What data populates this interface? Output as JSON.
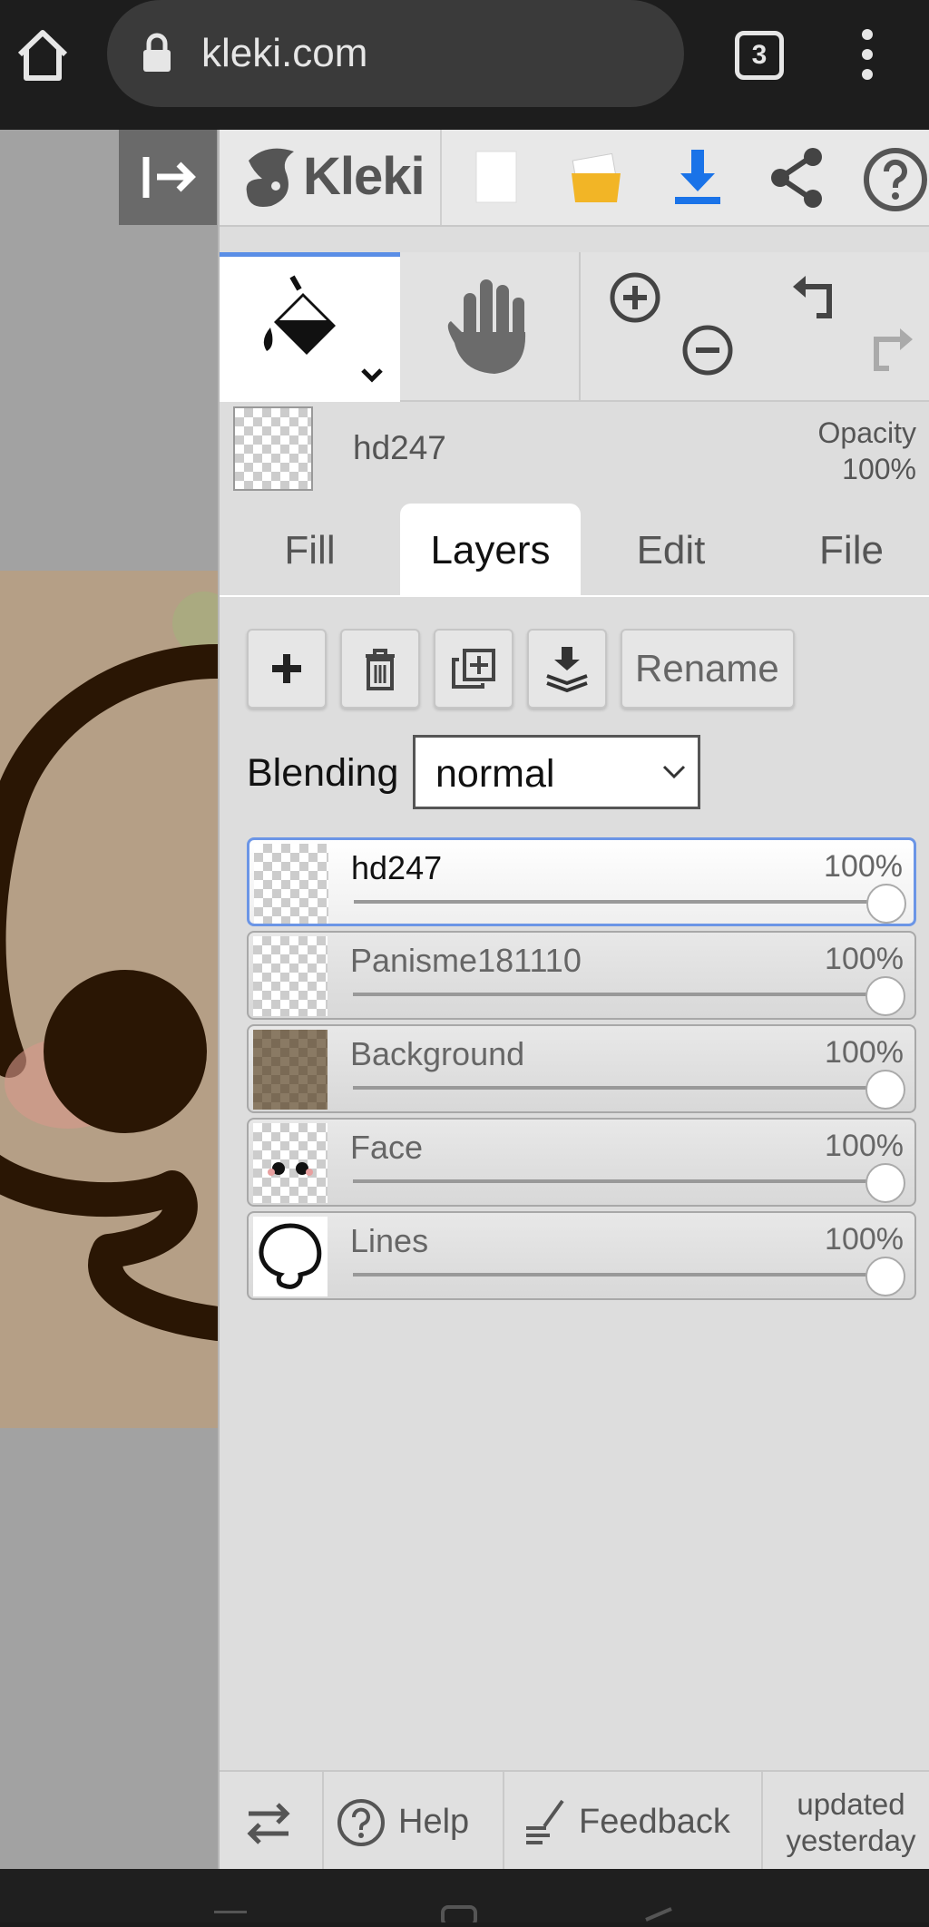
{
  "browser": {
    "url": "kleki.com",
    "tab_count": "3"
  },
  "app": {
    "logo": "Kleki"
  },
  "layer_header": {
    "name": "hd247",
    "opacity_label": "Opacity",
    "opacity_value": "100%"
  },
  "tabs": [
    "Fill",
    "Layers",
    "Edit",
    "File"
  ],
  "active_tab": "Layers",
  "layer_actions": {
    "rename_label": "Rename"
  },
  "blending": {
    "label": "Blending",
    "value": "normal"
  },
  "layers": [
    {
      "name": "hd247",
      "opacity": "100%",
      "opacity_value": 1.0,
      "selected": true
    },
    {
      "name": "Panisme181110",
      "opacity": "100%",
      "opacity_value": 1.0,
      "selected": false
    },
    {
      "name": "Background",
      "opacity": "100%",
      "opacity_value": 1.0,
      "selected": false
    },
    {
      "name": "Face",
      "opacity": "100%",
      "opacity_value": 1.0,
      "selected": false
    },
    {
      "name": "Lines",
      "opacity": "100%",
      "opacity_value": 1.0,
      "selected": false
    }
  ],
  "footer": {
    "help_label": "Help",
    "feedback_label": "Feedback",
    "updated_line1": "updated",
    "updated_line2": "yesterday"
  },
  "colors": {
    "accent": "#5a8ee6",
    "download_icon": "#1a73e8",
    "folder_icon": "#f2b526",
    "canvas_bg": "#b59f86",
    "ink": "#2a1604"
  },
  "icons": [
    "home-icon",
    "lock-icon",
    "tabs-icon",
    "overflow-menu-icon",
    "collapse-panel-icon",
    "kleki-logo-icon",
    "new-image-icon",
    "open-folder-icon",
    "download-icon",
    "share-icon",
    "help-icon",
    "paint-bucket-icon",
    "chevron-down-icon",
    "hand-icon",
    "zoom-in-icon",
    "zoom-out-icon",
    "undo-icon",
    "redo-icon",
    "add-layer-icon",
    "delete-layer-icon",
    "duplicate-layer-icon",
    "merge-down-icon",
    "swap-icon",
    "feedback-icon"
  ]
}
